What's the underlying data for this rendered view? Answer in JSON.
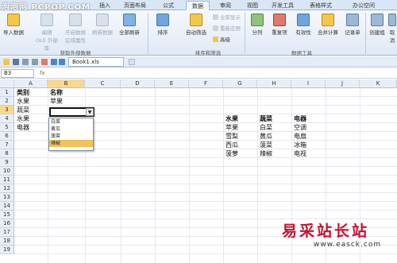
{
  "ribbon_tabs": [
    "插入",
    "页面布局",
    "公式",
    "数据",
    "审阅",
    "视图",
    "开发工具",
    "表格样式",
    "办公空间"
  ],
  "active_tab": "数据",
  "ribbon": {
    "import_data": "导入数据",
    "edit_links": "编辑",
    "edit_links_sub": "OLE 外部库",
    "open_data": "开启数据",
    "open_data_sub": "区域属性",
    "refresh_data": "刷新数据",
    "refresh_all": "全部刷新",
    "group_external": "获取外部数据",
    "sort": "排序",
    "auto_filter": "自动筛选",
    "show_all": "全部显示",
    "reapply": "重新应用",
    "advanced": "高级",
    "group_sort_filter": "排序和筛选",
    "split_columns": "分列",
    "duplicates": "重复项",
    "validity": "有效性",
    "consolidate": "合并计算",
    "record_sheet": "记录单",
    "create_group": "创建组",
    "ungroup": "取消",
    "group_tools": "数据工具"
  },
  "doc_tab": "Book1.xls",
  "name_box": "B3",
  "fx_label": "fx",
  "columns": [
    "A",
    "B",
    "C",
    "D",
    "E",
    "F",
    "G",
    "H",
    "I",
    "J",
    "K"
  ],
  "rows": [
    "1",
    "2",
    "3",
    "4",
    "5",
    "6",
    "7",
    "8",
    "9",
    "10",
    "11",
    "12",
    "13",
    "14",
    "15",
    "16",
    "17",
    "18",
    "19"
  ],
  "cells": {
    "a1": "类别",
    "b1": "名称",
    "a2": "水果",
    "b2": "苹果",
    "a3": "蔬菜",
    "a4": "水果",
    "a5": "电器"
  },
  "dropdown_options": [
    "白菜",
    "黄瓜",
    "菠菜",
    "辣椒"
  ],
  "dropdown_highlight": "辣椒",
  "lookup_table": {
    "headers": [
      "水果",
      "蔬菜",
      "电器"
    ],
    "rows": [
      [
        "苹果",
        "白菜",
        "空调"
      ],
      [
        "雪梨",
        "黄瓜",
        "电扇"
      ],
      [
        "西瓜",
        "菠菜",
        "冰箱"
      ],
      [
        "菠萝",
        "辣椒",
        "电视"
      ]
    ]
  },
  "watermark_top": "泡泡网 PCPOP.COM",
  "watermark_bottom_big": "易采站长站",
  "watermark_bottom_small": "www.easck.com",
  "colors": {
    "ribbon_bg": "#dfe9f6",
    "active_tab_bg": "#f3f7fc",
    "header_bg": "#e9eef6",
    "selected_header": "#f7d88f",
    "dropdown_highlight": "#f2c35a",
    "watermark_red": "#c8102e"
  }
}
